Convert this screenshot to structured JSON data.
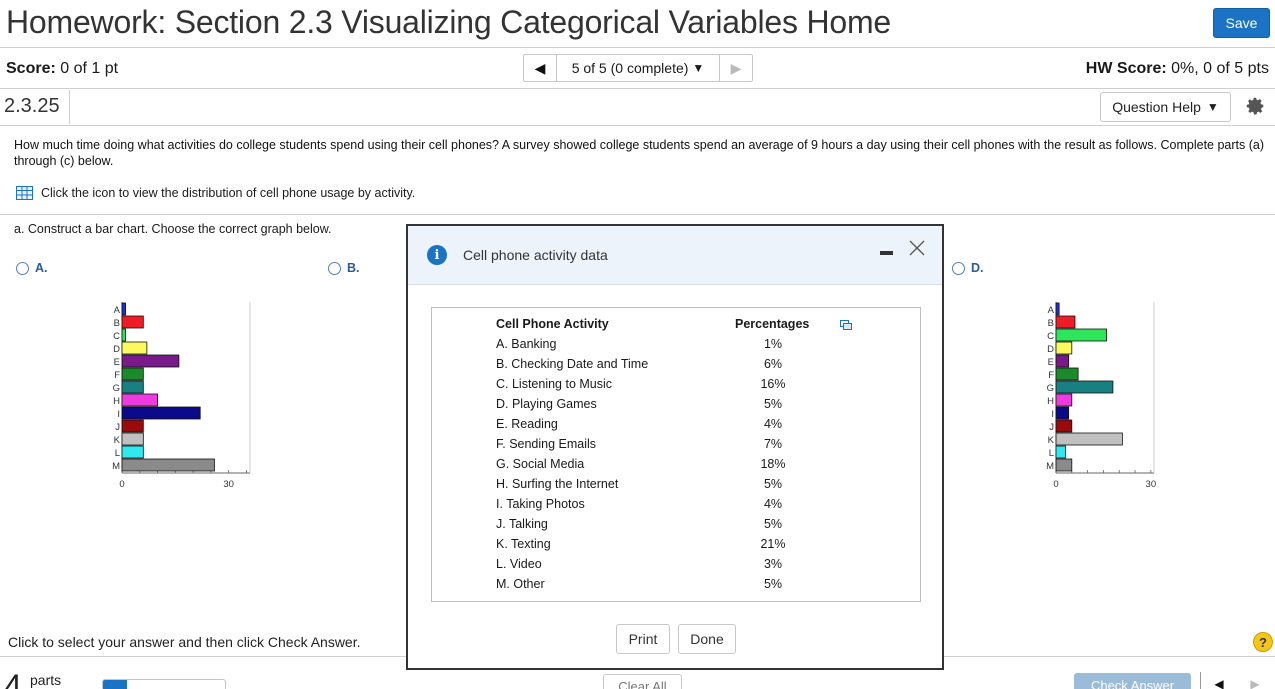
{
  "header": {
    "title": "Homework: Section 2.3 Visualizing Categorical Variables Home",
    "save_label": "Save"
  },
  "scorebar": {
    "score_label": "Score:",
    "score_value": "0 of 1 pt",
    "pager_text": "5 of 5 (0 complete)",
    "hw_score_label": "HW Score:",
    "hw_score_value": "0%, 0 of 5 pts"
  },
  "question": {
    "number": "2.3.25",
    "help_label": "Question Help",
    "prompt": "How much time doing what activities do college students spend using their cell phones? A survey showed college students spend an average of 9 hours a day using their cell phones with the result as follows. Complete parts (a) through (c) below.",
    "table_link": "Click the icon to view the distribution of cell phone usage by activity.",
    "part_a": "a. Construct a bar chart. Choose the correct graph below.",
    "options": [
      {
        "label": "A."
      },
      {
        "label": "B."
      },
      {
        "label": "D."
      }
    ]
  },
  "chart_data": [
    {
      "type": "bar",
      "orientation": "horizontal",
      "option": "A.",
      "categories": [
        "A",
        "B",
        "C",
        "D",
        "E",
        "F",
        "G",
        "H",
        "I",
        "J",
        "K",
        "L",
        "M"
      ],
      "values": [
        1,
        6,
        1,
        7,
        16,
        6,
        6,
        10,
        22,
        6,
        6,
        6,
        26
      ],
      "colors": [
        "#1f2fd6",
        "#ee1c24",
        "#2ee65a",
        "#fafa60",
        "#7a1a8a",
        "#1a8a2a",
        "#188080",
        "#ee3be0",
        "#0a0a8a",
        "#9a0a0a",
        "#c0c0c0",
        "#30e8f0",
        "#8a8a8a"
      ],
      "xlim": [
        0,
        36
      ],
      "xticks": [
        "0",
        "30"
      ]
    },
    {
      "type": "bar",
      "orientation": "horizontal",
      "option": "D.",
      "categories": [
        "A",
        "B",
        "C",
        "D",
        "E",
        "F",
        "G",
        "H",
        "I",
        "J",
        "K",
        "L",
        "M"
      ],
      "values": [
        1,
        6,
        16,
        5,
        4,
        7,
        18,
        5,
        4,
        5,
        21,
        3,
        5
      ],
      "colors": [
        "#1f2fd6",
        "#ee1c24",
        "#2ee65a",
        "#fafa60",
        "#7a1a8a",
        "#1a8a2a",
        "#188080",
        "#ee3be0",
        "#0a0a8a",
        "#9a0a0a",
        "#c0c0c0",
        "#30e8f0",
        "#8a8a8a"
      ],
      "xlim": [
        0,
        31
      ],
      "xticks": [
        "0",
        "30"
      ]
    }
  ],
  "modal": {
    "title": "Cell phone activity data",
    "col_activity": "Cell Phone Activity",
    "col_percent": "Percentages",
    "rows": [
      {
        "activity": "A. Banking",
        "pct": "1%"
      },
      {
        "activity": "B. Checking Date and Time",
        "pct": "6%"
      },
      {
        "activity": "C. Listening to Music",
        "pct": "16%"
      },
      {
        "activity": "D. Playing Games",
        "pct": "5%"
      },
      {
        "activity": "E. Reading",
        "pct": "4%"
      },
      {
        "activity": "F. Sending Emails",
        "pct": "7%"
      },
      {
        "activity": "G. Social Media",
        "pct": "18%"
      },
      {
        "activity": "H. Surfing the Internet",
        "pct": "5%"
      },
      {
        "activity": "I. Taking Photos",
        "pct": "4%"
      },
      {
        "activity": "J. Talking",
        "pct": "5%"
      },
      {
        "activity": "K. Texting",
        "pct": "21%"
      },
      {
        "activity": "L. Video",
        "pct": "3%"
      },
      {
        "activity": "M. Other",
        "pct": "5%"
      }
    ],
    "print_label": "Print",
    "done_label": "Done"
  },
  "footer": {
    "instruction": "Click to select your answer and then click Check Answer.",
    "parts_count": "4",
    "parts_label": "parts",
    "progress_fraction": 0.2,
    "clear_all_label": "Clear All",
    "check_answer_label": "Check Answer",
    "help_symbol": "?"
  }
}
